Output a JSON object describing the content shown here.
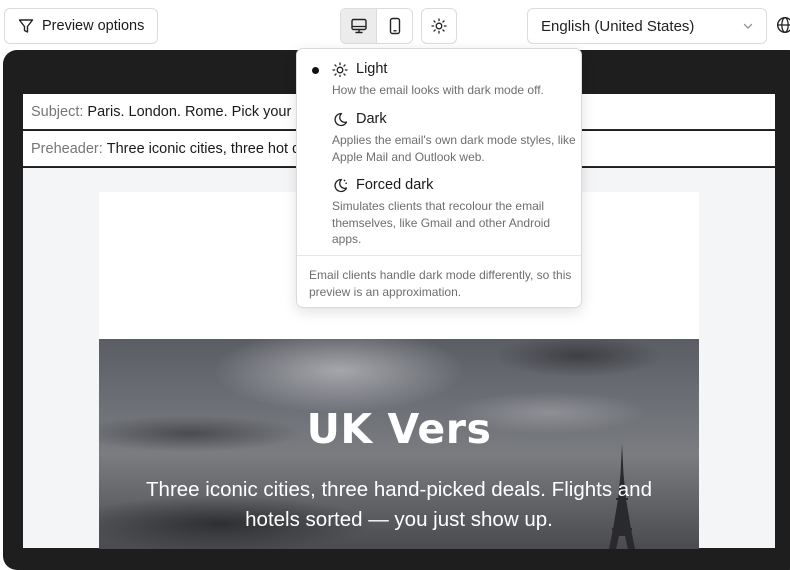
{
  "toolbar": {
    "preview_options_label": "Preview options",
    "language_value": "English (United States)"
  },
  "email": {
    "subject_label": "Subject:",
    "subject_value": "Paris. London. Rome. Pick your adventure.",
    "preheader_label": "Preheader:",
    "preheader_value": "Three iconic cities, three hot deals waiting for you.",
    "hero_title": "UK Vers",
    "hero_subtitle": "Three iconic cities, three hand-picked deals. Flights and hotels sorted — you just show up."
  },
  "theme_menu": {
    "selected": "Light",
    "items": [
      {
        "label": "Light",
        "description": "How the email looks with dark mode off.",
        "icon": "sun-icon"
      },
      {
        "label": "Dark",
        "description": "Applies the email's own dark mode styles, like Apple Mail and Outlook web.",
        "icon": "moon-icon"
      },
      {
        "label": "Forced dark",
        "description": "Simulates clients that recolour the email themselves, like Gmail and other Android apps.",
        "icon": "moon-forced-icon"
      }
    ],
    "footnote": "Email clients handle dark mode differently, so this preview is an approximation."
  },
  "colors": {
    "frame": "#1e1e1e",
    "canvas": "#f4f5f7",
    "muted_text": "#6e6e6e"
  }
}
